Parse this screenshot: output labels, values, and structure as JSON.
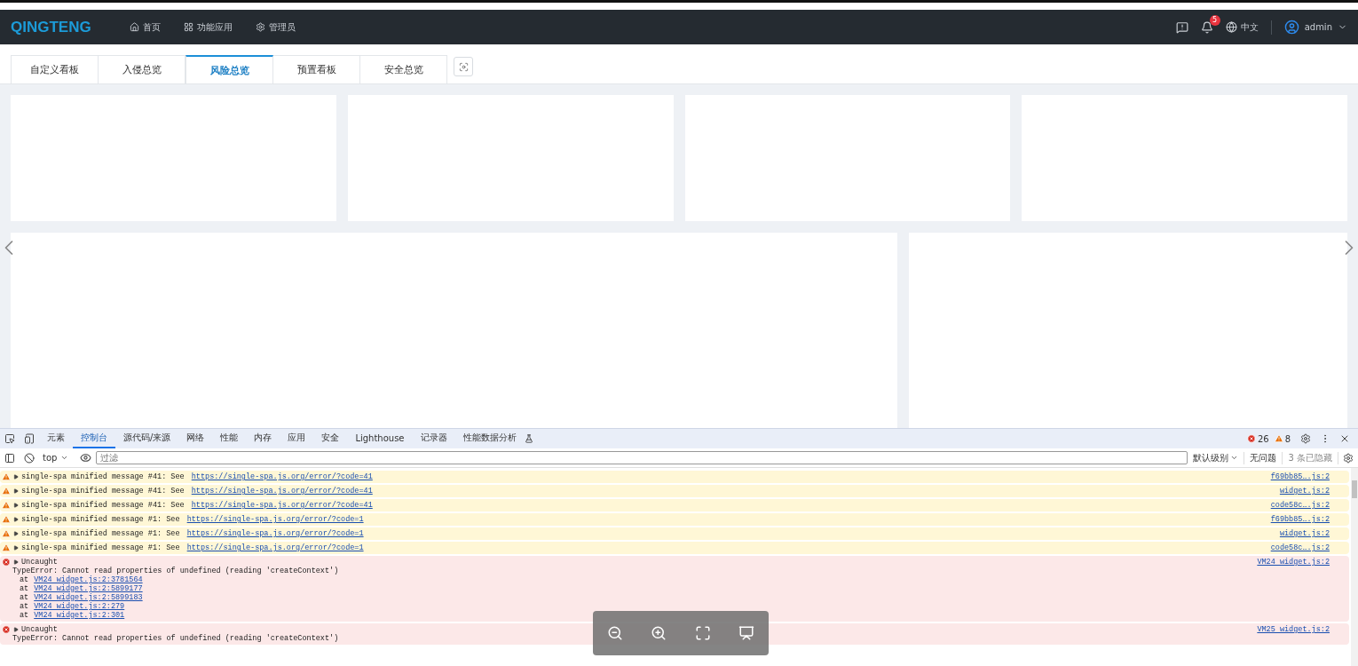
{
  "header": {
    "logo": "QINGTENG",
    "nav": [
      {
        "kind": "home",
        "label": "首页"
      },
      {
        "kind": "apps",
        "label": "功能应用"
      },
      {
        "kind": "admin",
        "label": "管理员"
      }
    ],
    "notification_count": "5",
    "language": "中文",
    "user": "admin"
  },
  "tabs": [
    {
      "label": "自定义看板",
      "selected": false
    },
    {
      "label": "入侵总览",
      "selected": false
    },
    {
      "label": "风险总览",
      "selected": true
    },
    {
      "label": "预置看板",
      "selected": false
    },
    {
      "label": "安全总览",
      "selected": false
    }
  ],
  "devtools": {
    "tabs": [
      {
        "label": "元素",
        "selected": false
      },
      {
        "label": "控制台",
        "selected": true
      },
      {
        "label": "源代码/来源",
        "selected": false
      },
      {
        "label": "网络",
        "selected": false
      },
      {
        "label": "性能",
        "selected": false
      },
      {
        "label": "内存",
        "selected": false
      },
      {
        "label": "应用",
        "selected": false
      },
      {
        "label": "安全",
        "selected": false
      },
      {
        "label": "Lighthouse",
        "selected": false
      },
      {
        "label": "记录器",
        "selected": false
      },
      {
        "label": "性能数据分析",
        "selected": false
      }
    ],
    "error_count": "26",
    "warning_count": "8",
    "context": "top",
    "filter": {
      "placeholder": "过滤"
    },
    "level": "默认级别",
    "issues": "无问题",
    "hidden": "3 条已隐藏",
    "messages": [
      {
        "kind": "warning",
        "text": "single-spa minified message #41: See ",
        "link": "https://single-spa.js.org/error/?code=41",
        "source": "f69bb85….js:2"
      },
      {
        "kind": "warning",
        "text": "single-spa minified message #41: See ",
        "link": "https://single-spa.js.org/error/?code=41",
        "source": "widget.js:2"
      },
      {
        "kind": "warning",
        "text": "single-spa minified message #41: See ",
        "link": "https://single-spa.js.org/error/?code=41",
        "source": "code58c….js:2"
      },
      {
        "kind": "warning",
        "text": "single-spa minified message #1: See ",
        "link": "https://single-spa.js.org/error/?code=1",
        "source": "f69bb85….js:2"
      },
      {
        "kind": "warning",
        "text": "single-spa minified message #1: See ",
        "link": "https://single-spa.js.org/error/?code=1",
        "source": "widget.js:2"
      },
      {
        "kind": "warning",
        "text": "single-spa minified message #1: See ",
        "link": "https://single-spa.js.org/error/?code=1",
        "source": "code58c….js:2"
      },
      {
        "kind": "error",
        "text": "Uncaught",
        "detail": "TypeError: Cannot read properties of undefined (reading 'createContext')",
        "stack": [
          {
            "prefix": "at",
            "link": "VM24 widget.js:2:3781564"
          },
          {
            "prefix": "at",
            "link": "VM24 widget.js:2:5899177"
          },
          {
            "prefix": "at",
            "link": "VM24 widget.js:2:5899183"
          },
          {
            "prefix": "at",
            "link": "VM24 widget.js:2:279"
          },
          {
            "prefix": "at",
            "link": "VM24 widget.js:2:301"
          }
        ],
        "source": "VM24 widget.js:2"
      },
      {
        "kind": "error",
        "text": "Uncaught",
        "detail": "TypeError: Cannot read properties of undefined (reading 'createContext')",
        "source": "VM25 widget.js:2"
      }
    ]
  }
}
